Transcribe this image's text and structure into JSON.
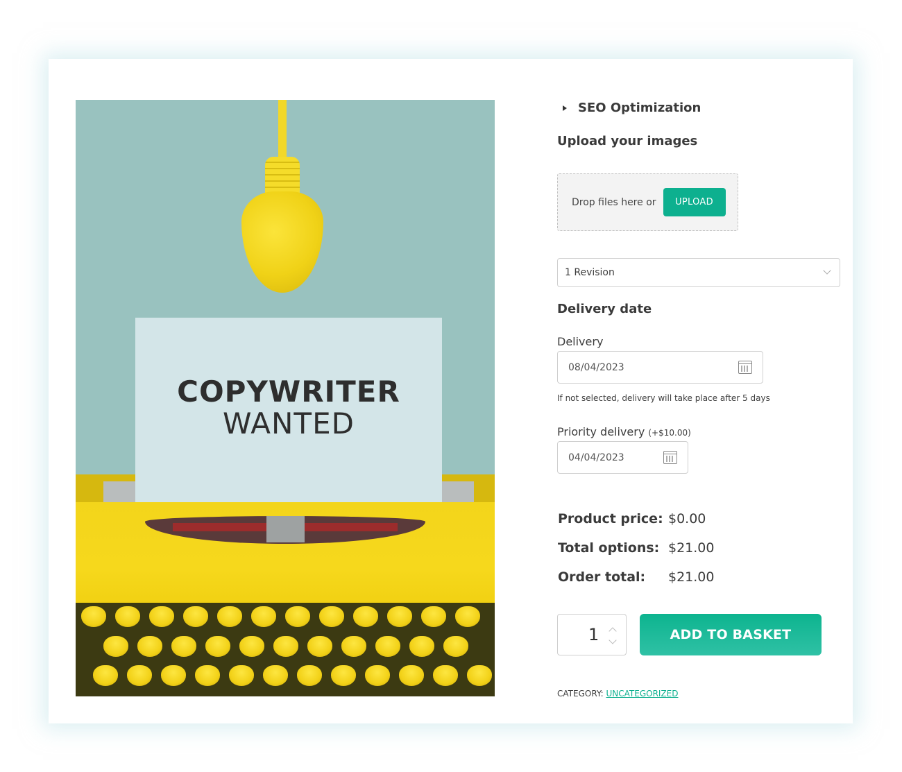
{
  "product_image": {
    "alt": "Yellow typewriter with hanging yellow light bulb and a paper sheet",
    "paper_line1": "COPYWRITER",
    "paper_line2": "WANTED"
  },
  "options": {
    "seo": {
      "label": "SEO Optimization",
      "icon": "triangle-right-icon"
    },
    "upload": {
      "heading": "Upload your images",
      "drop_text": "Drop files here or",
      "button_label": "UPLOAD"
    },
    "revision_select": {
      "selected": "1 Revision",
      "icon": "chevron-down-icon"
    },
    "delivery": {
      "heading": "Delivery date",
      "delivery_label": "Delivery",
      "delivery_value": "08/04/2023",
      "help_text": "If not selected, delivery will take place after 5 days",
      "priority_label": "Priority delivery",
      "priority_extra": "(+$10.00)",
      "priority_value": "04/04/2023",
      "icon": "calendar-icon"
    }
  },
  "totals": {
    "product_price_label": "Product price:",
    "product_price_value": "$0.00",
    "total_options_label": "Total options:",
    "total_options_value": "$21.00",
    "order_total_label": "Order total:",
    "order_total_value": "$21.00"
  },
  "cart": {
    "quantity": "1",
    "add_button_label": "ADD TO BASKET"
  },
  "meta": {
    "category_label": "CATEGORY:",
    "category_link": "UNCATEGORIZED"
  },
  "colors": {
    "accent": "#0db08f",
    "text": "#3a3a3a",
    "dropzone_bg": "#f3f3f3"
  }
}
